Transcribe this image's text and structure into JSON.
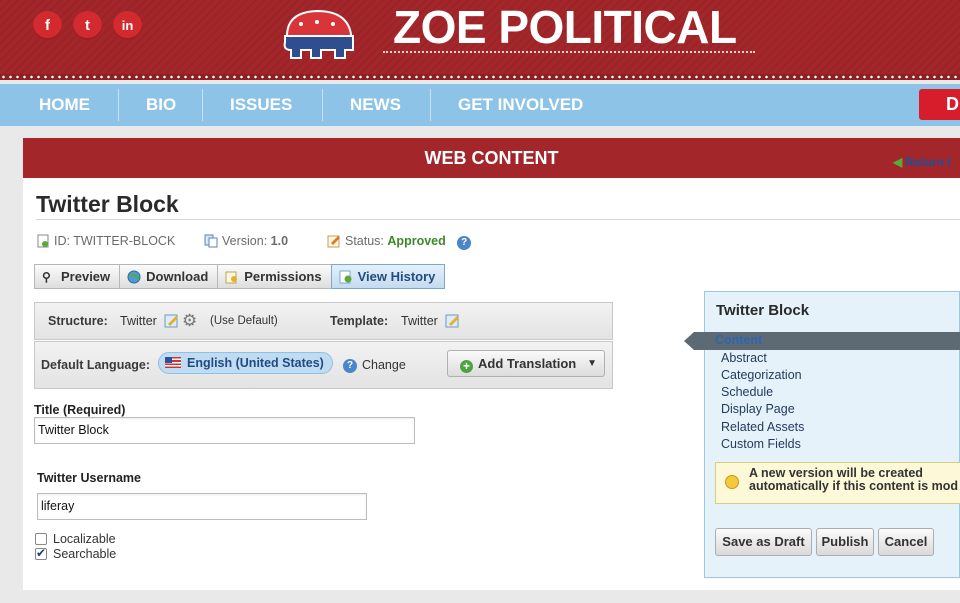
{
  "site": {
    "brand": "ZOE POLITICAL",
    "social": [
      {
        "icon": "facebook-icon",
        "glyph": "f"
      },
      {
        "icon": "twitter-icon",
        "glyph": "t"
      },
      {
        "icon": "linkedin-icon",
        "glyph": "in"
      }
    ],
    "nav": [
      "HOME",
      "BIO",
      "ISSUES",
      "NEWS",
      "GET INVOLVED"
    ],
    "donate_label": "D"
  },
  "header": {
    "bar_title": "WEB CONTENT",
    "return_label": "Return t"
  },
  "content": {
    "title": "Twitter Block",
    "id_text": "ID: TWITTER-BLOCK",
    "version_label": "Version:",
    "version_value": "1.0",
    "status_label": "Status:",
    "status_value": "Approved",
    "tabs": [
      "Preview",
      "Download",
      "Permissions",
      "View History"
    ]
  },
  "structure": {
    "structure_label": "Structure:",
    "structure_value": "Twitter",
    "use_default": "(Use Default)",
    "template_label": "Template:",
    "template_value": "Twitter"
  },
  "language": {
    "label": "Default Language:",
    "value": "English (United States)",
    "change_label": "Change",
    "add_translation_label": "Add Translation"
  },
  "form": {
    "title_label": "Title (Required)",
    "title_value": "Twitter Block",
    "username_label": "Twitter Username",
    "username_value": "liferay",
    "localizable_label": "Localizable",
    "localizable_checked": false,
    "searchable_label": "Searchable",
    "searchable_checked": true
  },
  "sidebar": {
    "title": "Twitter Block",
    "active_item": "Content",
    "items": [
      "Abstract",
      "Categorization",
      "Schedule",
      "Display Page",
      "Related Assets",
      "Custom Fields"
    ],
    "notice_line1": "A new version will be created",
    "notice_line2": "automatically if this content is mod",
    "buttons": [
      "Save as Draft",
      "Publish",
      "Cancel"
    ]
  },
  "colors": {
    "brand_red": "#a3262a",
    "nav_blue": "#8dc3e6",
    "approved_green": "#3c8b2a"
  }
}
